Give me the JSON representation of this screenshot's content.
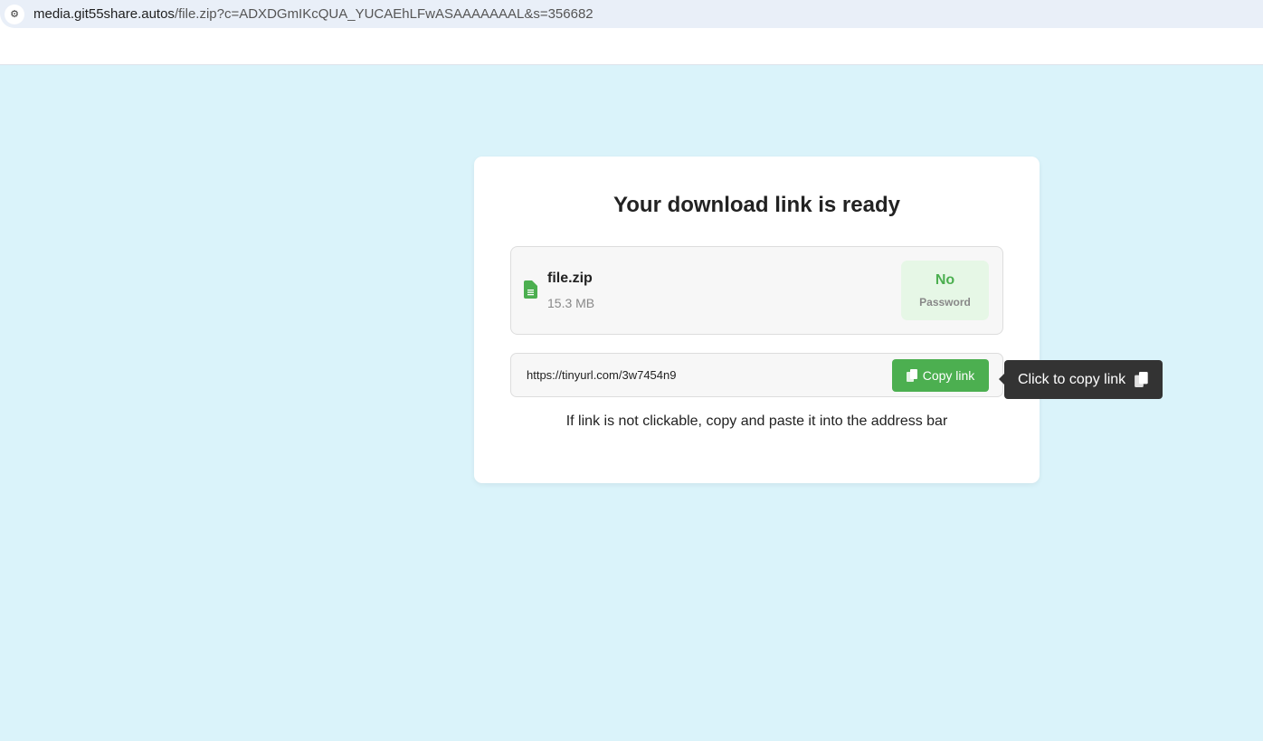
{
  "browser": {
    "url_domain": "media.git55share.autos",
    "url_rest": "/file.zip?c=ADXDGmIKcQUA_YUCAEhLFwASAAAAAAAL&s=356682"
  },
  "card": {
    "title": "Your download link is ready",
    "file": {
      "name": "file.zip",
      "size": "15.3 MB",
      "password_status": "No",
      "password_label": "Password"
    },
    "link": {
      "url": "https://tinyurl.com/3w7454n9",
      "copy_label": "Copy link"
    },
    "note": "If link is not clickable, copy and paste it into the address bar"
  },
  "tooltip": {
    "text": "Click to copy link"
  },
  "colors": {
    "accent": "#4caf50",
    "background": "#daf3fa"
  }
}
